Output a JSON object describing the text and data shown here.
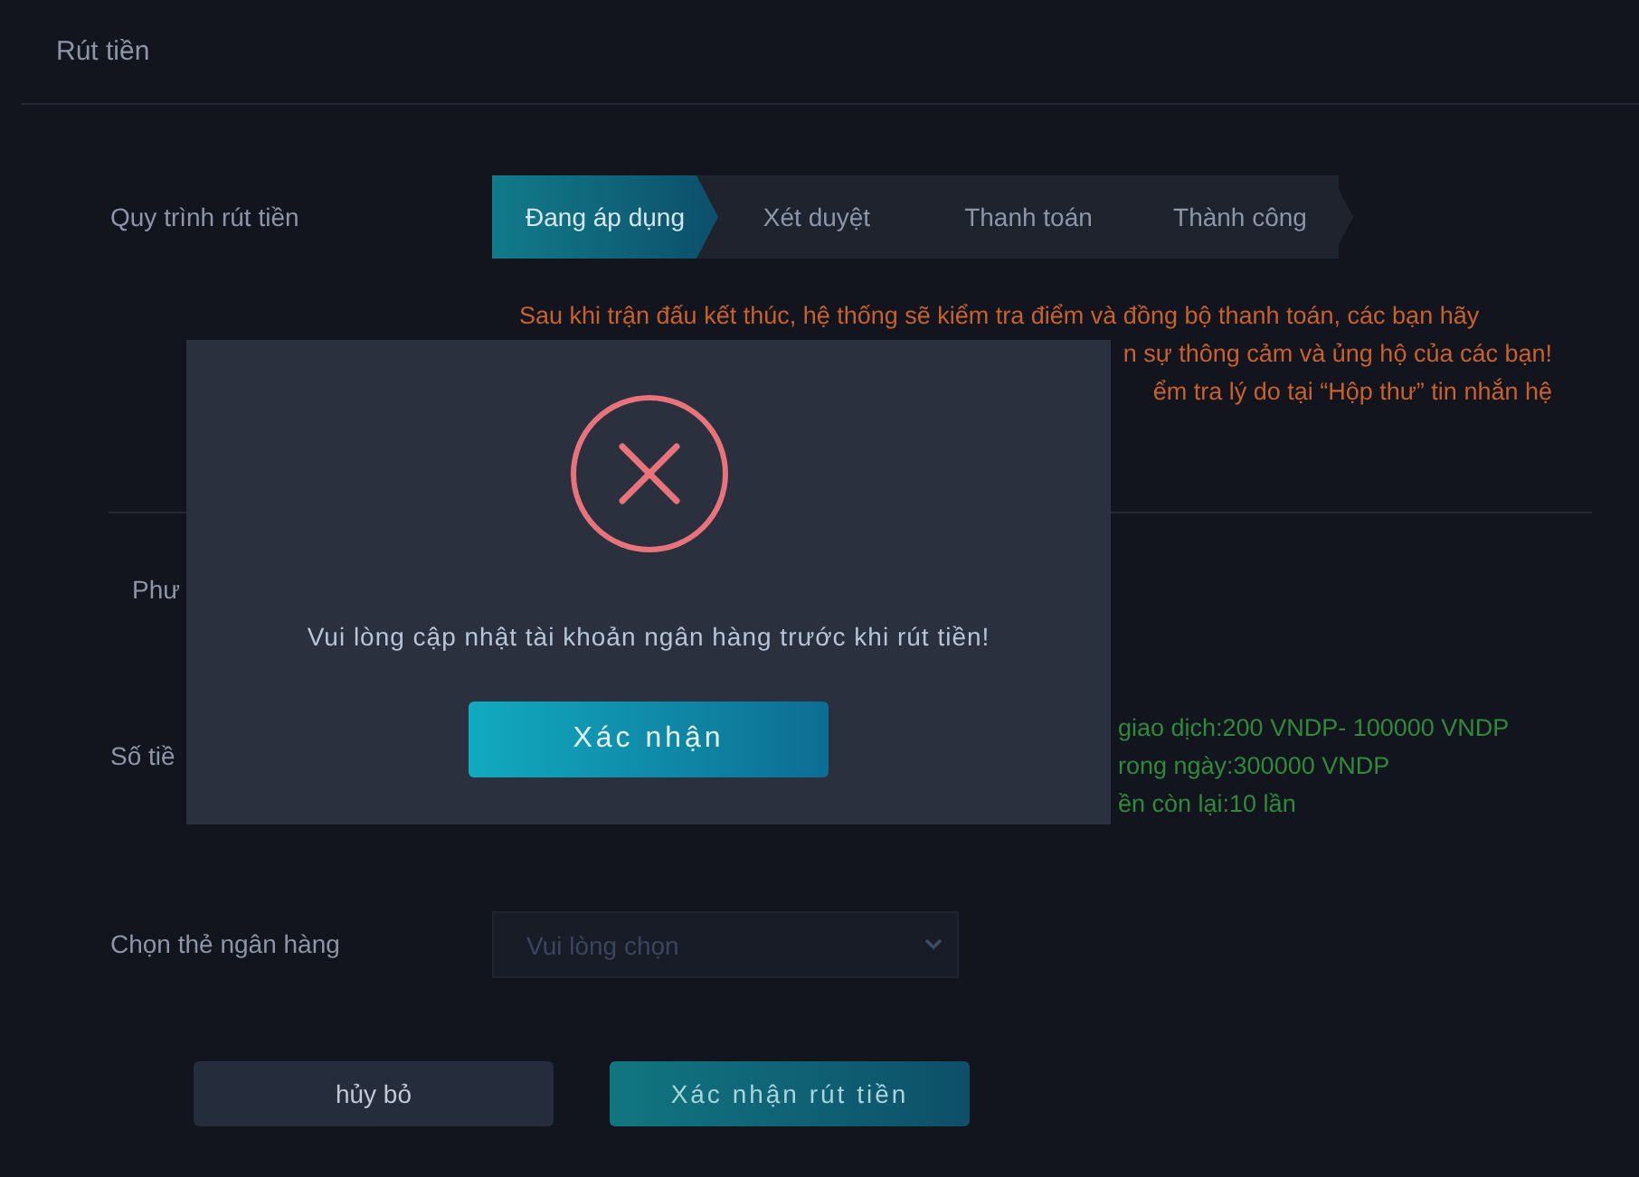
{
  "page_title": "Rút tiền",
  "process": {
    "label": "Quy trình rút tiền",
    "steps": [
      {
        "label": "Đang áp dụng",
        "selected": true
      },
      {
        "label": "Xét duyệt",
        "selected": false
      },
      {
        "label": "Thanh toán",
        "selected": false
      },
      {
        "label": "Thành công",
        "selected": false
      }
    ],
    "notice_lines": [
      "Sau khi trận đấu kết thúc, hệ thống sẽ kiểm tra điểm và đồng bộ thanh toán, các bạn hãy",
      "n sự thông cảm và ủng hộ của các bạn!",
      "ểm tra lý do tại “Hộp thư” tin nhắn hệ"
    ]
  },
  "method": {
    "label": "Phư"
  },
  "amount": {
    "label": "Số tiề",
    "limits": [
      "giao dịch:200 VNDP- 100000 VNDP",
      "rong ngày:300000 VNDP",
      "ền còn lại:10 lần"
    ]
  },
  "bank_card": {
    "label": "Chọn thẻ ngân hàng",
    "placeholder": "Vui lòng chọn"
  },
  "buttons": [
    {
      "label": "hủy bỏ",
      "kind": "secondary"
    },
    {
      "label": "Xác nhận rút tiền",
      "kind": "primary"
    }
  ],
  "dialog": {
    "message": "Vui lòng cập nhật tài khoản ngân hàng trước khi rút tiền!",
    "button": "Xác nhận"
  }
}
